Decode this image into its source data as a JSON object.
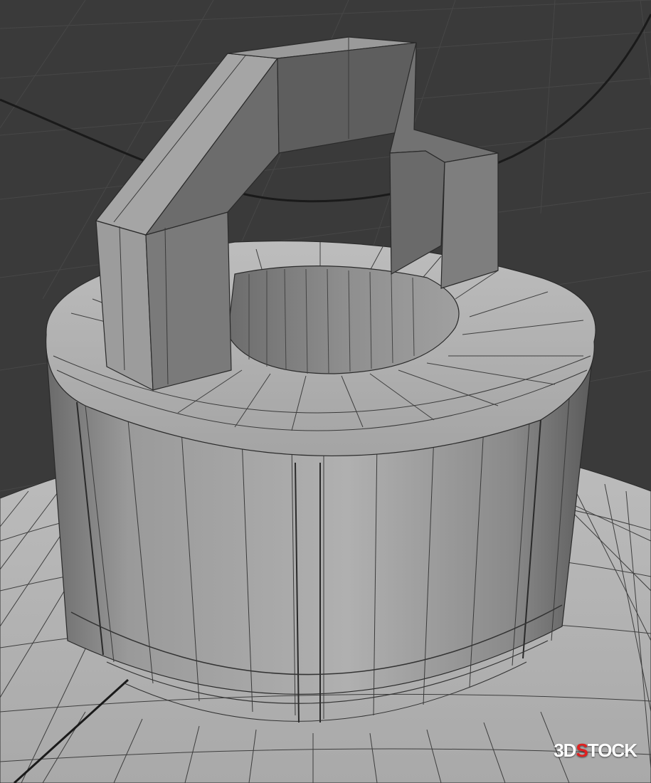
{
  "watermark": {
    "prefix": "3D",
    "accent": "S",
    "suffix": "TOCK"
  },
  "colors": {
    "background": "#3a3a3a",
    "grid": "#474747",
    "mesh_light": "#a8a8a8",
    "mesh_mid": "#8f8f8f",
    "mesh_dark": "#5e5e5e",
    "wire": "#1e1e1e",
    "watermark_accent": "#e02020"
  },
  "icons": [
    "3d-viewport-grid",
    "wireframe-mesh"
  ]
}
